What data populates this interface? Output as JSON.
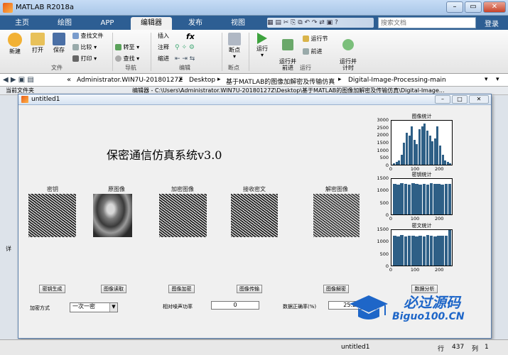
{
  "app": {
    "title": "MATLAB R2018a"
  },
  "tabs": [
    {
      "label": "主页"
    },
    {
      "label": "绘图"
    },
    {
      "label": "APP"
    },
    {
      "label": "编辑器"
    },
    {
      "label": "发布"
    },
    {
      "label": "视图"
    }
  ],
  "search": {
    "placeholder": "搜索文档"
  },
  "login_label": "登录",
  "ribbon": {
    "new": "新建",
    "open": "打开",
    "save": "保存",
    "find_files": "查找文件",
    "compare": "比较",
    "print": "打印",
    "goto": "转至",
    "find": "查找",
    "insert": "插入",
    "comment": "注释",
    "indent": "缩进",
    "breakpoints": "断点",
    "run": "运行",
    "run_advance": "运行并\n前进",
    "run_section": "运行节",
    "advance": "前进",
    "run_time": "运行并\n计时",
    "group_file": "文件",
    "group_nav": "导航",
    "group_edit": "编辑",
    "group_bp": "断点",
    "group_run": "运行"
  },
  "path": {
    "prefix": "«",
    "segments": [
      "Administrator.WIN7U-20180127Z",
      "Desktop",
      "基于MATLAB的图像加解密及传输仿真",
      "Digital-Image-Processing-main"
    ]
  },
  "panels": {
    "current_folder": "当前文件夹",
    "editor_prefix": "编辑器 - C:\\Users\\Administrator.WIN7U-20180127Z\\Desktop\\基于MATLAB的图像加解密及传输仿真\\Digital-Image...",
    "details": "详"
  },
  "figure": {
    "title": "untitled1",
    "heading": "保密通信仿真系统v3.0",
    "image_labels": [
      "密钥",
      "原图像",
      "加密图像",
      "接收密文",
      "解密图像"
    ],
    "buttons": [
      "密钥生成",
      "图像读取",
      "图像加密",
      "图像传输",
      "图像解密",
      "数据分析"
    ],
    "encrypt_label": "加密方式",
    "encrypt_value": "一次一密",
    "noise_label": "相对噪声功率",
    "noise_value": "0",
    "accuracy_label": "数据正确率(%)",
    "accuracy_value": "25.2%"
  },
  "chart_data": [
    {
      "type": "bar",
      "title": "图像统计",
      "xlim": [
        0,
        255
      ],
      "ylim": [
        0,
        3000
      ],
      "xticks": [
        "0",
        "100",
        "200"
      ],
      "yticks": [
        "0",
        "500",
        "1000",
        "1500",
        "2000",
        "2500",
        "3000"
      ],
      "x": [
        10,
        20,
        30,
        40,
        50,
        60,
        70,
        80,
        90,
        100,
        110,
        120,
        130,
        140,
        150,
        160,
        170,
        180,
        190,
        200,
        210,
        220,
        230
      ],
      "values": [
        100,
        200,
        300,
        700,
        1500,
        2200,
        2000,
        2600,
        1700,
        1400,
        2400,
        2600,
        2800,
        2300,
        2000,
        1600,
        1800,
        2600,
        1300,
        700,
        300,
        200,
        100
      ]
    },
    {
      "type": "bar",
      "title": "密钥统计",
      "xlim": [
        0,
        255
      ],
      "ylim": [
        0,
        1500
      ],
      "xticks": [
        "0",
        "100",
        "200"
      ],
      "yticks": [
        "0",
        "500",
        "1000",
        "1500"
      ],
      "values": [
        1300,
        1250,
        1310,
        1280,
        1260,
        1320,
        1290,
        1270,
        1300,
        1250,
        1310,
        1280,
        1300,
        1260,
        1290,
        1300
      ]
    },
    {
      "type": "bar",
      "title": "密文统计",
      "xlim": [
        0,
        255
      ],
      "ylim": [
        0,
        1500
      ],
      "xticks": [
        "0",
        "100",
        "200"
      ],
      "yticks": [
        "0",
        "500",
        "1000",
        "1500"
      ],
      "values": [
        1260,
        1240,
        1280,
        1230,
        1270,
        1250,
        1240,
        1260,
        1230,
        1280,
        1250,
        1240,
        1270,
        1260,
        1250,
        1500
      ]
    }
  ],
  "status": {
    "file": "untitled1",
    "row_label": "行",
    "row": "437",
    "col_label": "列",
    "col": "1"
  },
  "watermark": {
    "brand": "必过源码",
    "domain": "Biguo100.CN"
  }
}
